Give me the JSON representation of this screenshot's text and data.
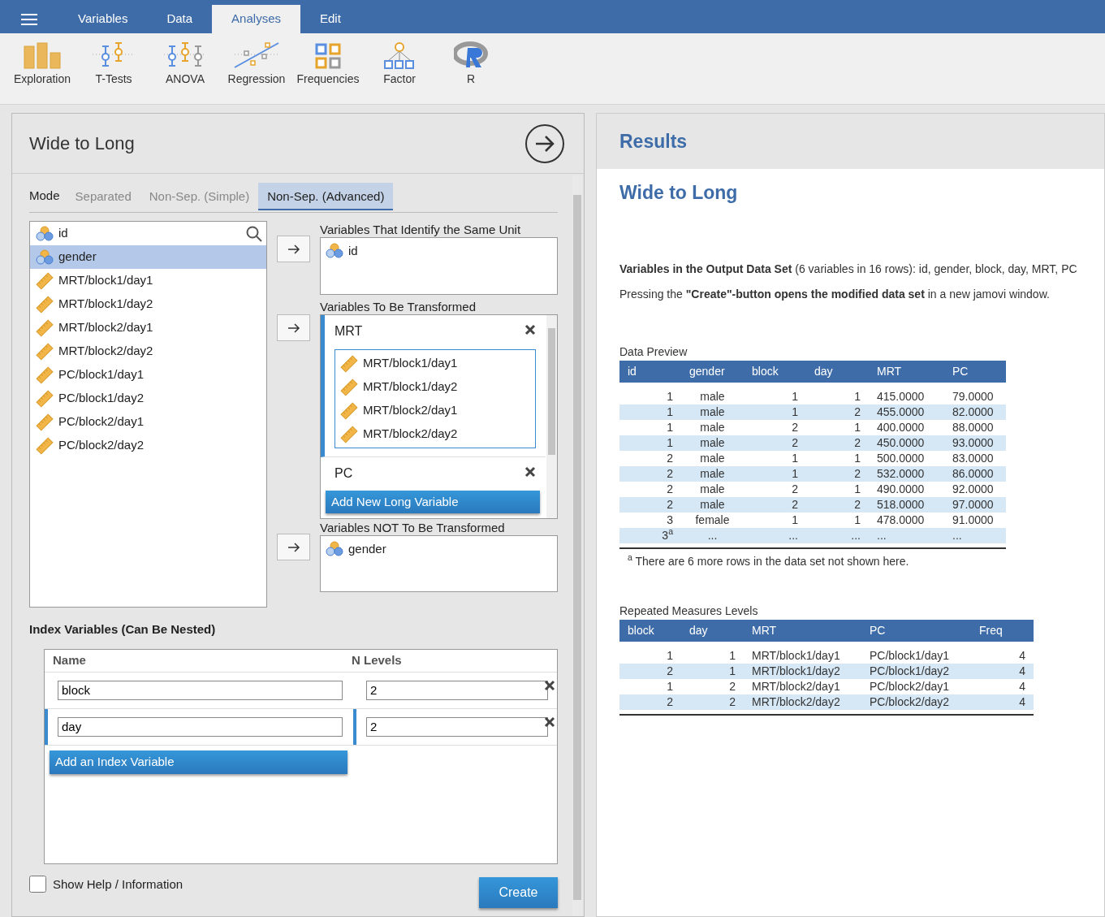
{
  "menu_tabs": [
    {
      "label": "Variables",
      "selected": false
    },
    {
      "label": "Data",
      "selected": false
    },
    {
      "label": "Analyses",
      "selected": true
    },
    {
      "label": "Edit",
      "selected": false
    }
  ],
  "ribbon": [
    {
      "label": "Exploration",
      "kind": "bars"
    },
    {
      "label": "T-Tests",
      "kind": "ttest"
    },
    {
      "label": "ANOVA",
      "kind": "anova"
    },
    {
      "label": "Regression",
      "kind": "regression"
    },
    {
      "label": "Frequencies",
      "kind": "grid"
    },
    {
      "label": "Factor",
      "kind": "tree"
    },
    {
      "label": "R",
      "kind": "r"
    }
  ],
  "panel": {
    "title": "Wide to Long",
    "mode_label": "Mode",
    "mode_tabs": [
      {
        "label": "Separated",
        "selected": false
      },
      {
        "label": "Non-Sep. (Simple)",
        "selected": false
      },
      {
        "label": "Non-Sep. (Advanced)",
        "selected": true
      }
    ],
    "variables": [
      {
        "name": "id",
        "kind": "nominal",
        "selected": false
      },
      {
        "name": "gender",
        "kind": "nominal",
        "selected": true
      },
      {
        "name": "MRT/block1/day1",
        "kind": "continuous",
        "selected": false
      },
      {
        "name": "MRT/block1/day2",
        "kind": "continuous",
        "selected": false
      },
      {
        "name": "MRT/block2/day1",
        "kind": "continuous",
        "selected": false
      },
      {
        "name": "MRT/block2/day2",
        "kind": "continuous",
        "selected": false
      },
      {
        "name": "PC/block1/day1",
        "kind": "continuous",
        "selected": false
      },
      {
        "name": "PC/block1/day2",
        "kind": "continuous",
        "selected": false
      },
      {
        "name": "PC/block2/day1",
        "kind": "continuous",
        "selected": false
      },
      {
        "name": "PC/block2/day2",
        "kind": "continuous",
        "selected": false
      }
    ],
    "same_unit": {
      "label": "Variables That Identify the Same Unit",
      "items": [
        {
          "name": "id",
          "kind": "nominal"
        }
      ]
    },
    "transformed": {
      "label": "Variables To Be Transformed",
      "long_variables": [
        {
          "name": "MRT",
          "selected": true,
          "items": [
            {
              "name": "MRT/block1/day1",
              "kind": "continuous"
            },
            {
              "name": "MRT/block1/day2",
              "kind": "continuous"
            },
            {
              "name": "MRT/block2/day1",
              "kind": "continuous"
            },
            {
              "name": "MRT/block2/day2",
              "kind": "continuous"
            }
          ]
        },
        {
          "name": "PC",
          "selected": false
        }
      ],
      "add_button": "Add New Long Variable"
    },
    "not_transformed": {
      "label": "Variables NOT To Be Transformed",
      "items": [
        {
          "name": "gender",
          "kind": "nominal"
        }
      ]
    },
    "index": {
      "title": "Index Variables (Can Be Nested)",
      "columns": [
        "Name",
        "N Levels"
      ],
      "rows": [
        {
          "name": "block",
          "levels": "2",
          "selected": false
        },
        {
          "name": "day",
          "levels": "2",
          "selected": true
        }
      ],
      "add_button": "Add an Index Variable"
    },
    "show_help": {
      "label": "Show Help / Information",
      "checked": false
    },
    "create_button": "Create"
  },
  "results": {
    "header": "Results",
    "title": "Wide to Long",
    "paragraphs": [
      "**Variables in the Output Data Set** (6 variables in 16 rows): id, gender, block, day, MRT, PC",
      "Pressing the **\"Create\"-button opens the modified data set** in a new jamovi window."
    ],
    "preview": {
      "title": "Data Preview",
      "columns": [
        "id",
        "gender",
        "block",
        "day",
        "MRT",
        "PC"
      ],
      "rows": [
        [
          "1",
          "male",
          "1",
          "1",
          "415.0000",
          "79.0000"
        ],
        [
          "1",
          "male",
          "1",
          "2",
          "455.0000",
          "82.0000"
        ],
        [
          "1",
          "male",
          "2",
          "1",
          "400.0000",
          "88.0000"
        ],
        [
          "1",
          "male",
          "2",
          "2",
          "450.0000",
          "93.0000"
        ],
        [
          "2",
          "male",
          "1",
          "1",
          "500.0000",
          "83.0000"
        ],
        [
          "2",
          "male",
          "1",
          "2",
          "532.0000",
          "86.0000"
        ],
        [
          "2",
          "male",
          "2",
          "1",
          "490.0000",
          "92.0000"
        ],
        [
          "2",
          "male",
          "2",
          "2",
          "518.0000",
          "97.0000"
        ],
        [
          "3",
          "female",
          "1",
          "1",
          "478.0000",
          "91.0000"
        ],
        [
          "3$^{a}$",
          "...",
          "...",
          "...",
          "...",
          "..."
        ]
      ],
      "footnote": "$^{a}$ There are 6 more rows in the data set not shown here."
    },
    "levels": {
      "title": "Repeated Measures Levels",
      "columns": [
        "block",
        "day",
        "MRT",
        "PC",
        "Freq"
      ],
      "rows": [
        [
          "1",
          "1",
          "MRT/block1/day1",
          "PC/block1/day1",
          "4"
        ],
        [
          "2",
          "1",
          "MRT/block1/day2",
          "PC/block1/day2",
          "4"
        ],
        [
          "1",
          "2",
          "MRT/block2/day1",
          "PC/block2/day1",
          "4"
        ],
        [
          "2",
          "2",
          "MRT/block2/day2",
          "PC/block2/day2",
          "4"
        ]
      ]
    }
  }
}
